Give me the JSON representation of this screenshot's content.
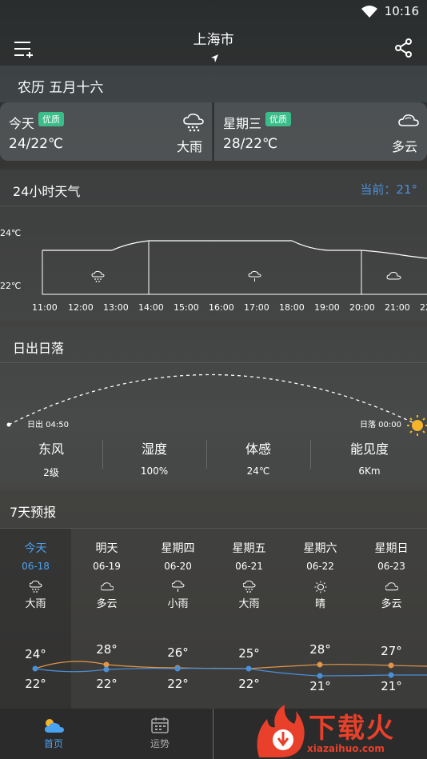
{
  "status": {
    "time": "10:16"
  },
  "header": {
    "city": "上海市"
  },
  "lunar": "农历 五月十六",
  "cards": [
    {
      "day": "今天",
      "badge": "优质",
      "temp": "24/22℃",
      "cond": "大雨",
      "icon": "rain-cloud-icon"
    },
    {
      "day": "星期三",
      "badge": "优质",
      "temp": "28/22℃",
      "cond": "多云",
      "icon": "cloud-icon"
    }
  ],
  "hourly": {
    "title": "24小时天气",
    "now": "当前：21°",
    "y_top": "24℃",
    "y_bottom": "22℃",
    "times": [
      "11:00",
      "12:00",
      "13:00",
      "14:00",
      "15:00",
      "16:00",
      "17:00",
      "18:00",
      "19:00",
      "20:00",
      "21:00",
      "22"
    ]
  },
  "sun": {
    "title": "日出日落",
    "rise": "日出 04:50",
    "set": "日落 00:00",
    "info": [
      {
        "label": "东风",
        "value": "2级"
      },
      {
        "label": "湿度",
        "value": "100%"
      },
      {
        "label": "体感",
        "value": "24℃"
      },
      {
        "label": "能见度",
        "value": "6Km"
      }
    ]
  },
  "week": {
    "title": "7天预报",
    "days": [
      {
        "name": "今天",
        "date": "06-18",
        "cond": "大雨",
        "icon": "rain-icon",
        "hi": "24°",
        "lo": "22°"
      },
      {
        "name": "明天",
        "date": "06-19",
        "cond": "多云",
        "icon": "cloud-icon",
        "hi": "28°",
        "lo": "22°"
      },
      {
        "name": "星期四",
        "date": "06-20",
        "cond": "小雨",
        "icon": "light-rain-icon",
        "hi": "26°",
        "lo": "22°"
      },
      {
        "name": "星期五",
        "date": "06-21",
        "cond": "大雨",
        "icon": "rain-icon",
        "hi": "25°",
        "lo": "22°"
      },
      {
        "name": "星期六",
        "date": "06-22",
        "cond": "晴",
        "icon": "sun-icon",
        "hi": "28°",
        "lo": "21°"
      },
      {
        "name": "星期日",
        "date": "06-23",
        "cond": "多云",
        "icon": "cloud-icon",
        "hi": "27°",
        "lo": "21°"
      }
    ]
  },
  "nav": [
    {
      "label": "首页"
    },
    {
      "label": "运势"
    }
  ],
  "watermark": {
    "text": "下载火",
    "url": "xiazaihuo.com"
  },
  "colors": {
    "accent": "#4aa3f0",
    "badge": "#3bbd8a",
    "high_line": "#e0964a",
    "low_line": "#4a90d9"
  }
}
